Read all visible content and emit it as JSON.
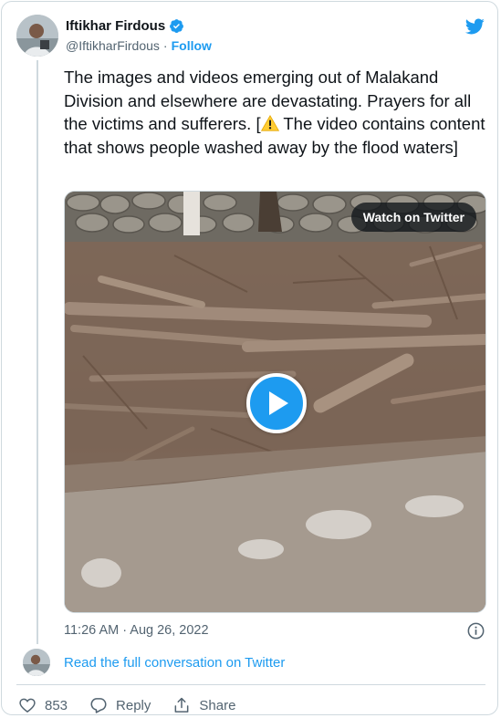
{
  "author": {
    "name": "Iftikhar Firdous",
    "handle": "@IftikharFirdous",
    "separator": "·",
    "follow_label": "Follow"
  },
  "tweet": {
    "text_before_icon": "The images and videos emerging out of Malakand Division and elsewhere are devastating. Prayers for all the victims and sufferers. [",
    "text_after_icon": " The video contains content that shows people washed away by the flood waters]"
  },
  "media": {
    "watch_label": "Watch on Twitter"
  },
  "timestamp": "11:26 AM · Aug 26, 2022",
  "read_conversation_label": "Read the full conversation on Twitter",
  "actions": {
    "likes_count": "853",
    "reply_label": "Reply",
    "share_label": "Share"
  },
  "icons": {
    "verified": "verified-badge-icon",
    "twitter": "twitter-bird-icon",
    "warning": "warning-icon",
    "play": "play-icon",
    "info": "info-icon",
    "heart": "heart-icon",
    "reply": "reply-icon",
    "share": "share-icon"
  },
  "colors": {
    "accent": "#1d9bf0",
    "text": "#0f1419",
    "muted": "#536471",
    "border": "#cfd9de"
  }
}
